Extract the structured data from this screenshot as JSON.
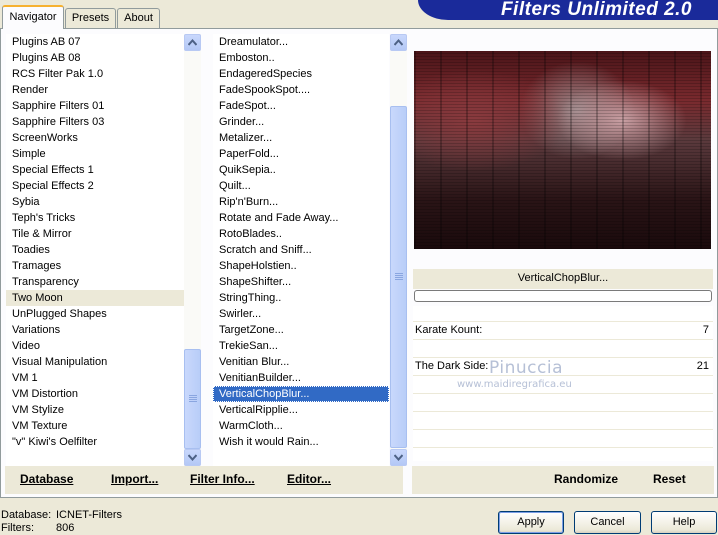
{
  "title": "Filters Unlimited 2.0",
  "tabs": [
    {
      "label": "Navigator",
      "active": true
    },
    {
      "label": "Presets",
      "active": false
    },
    {
      "label": "About",
      "active": false
    }
  ],
  "categories": {
    "items": [
      "Plugins AB 07",
      "Plugins AB 08",
      "RCS Filter Pak 1.0",
      "Render",
      "Sapphire Filters 01",
      "Sapphire Filters 03",
      "ScreenWorks",
      "Simple",
      "Special Effects 1",
      "Special Effects 2",
      "Sybia",
      "Teph's Tricks",
      "Tile & Mirror",
      "Toadies",
      "Tramages",
      "Transparency",
      "Two Moon",
      "UnPlugged Shapes",
      "Variations",
      "Video",
      "Visual Manipulation",
      "VM 1",
      "VM Distortion",
      "VM Stylize",
      "VM Texture",
      "\"v\" Kiwi's Oelfilter"
    ],
    "selected": "Two Moon"
  },
  "filters": {
    "items": [
      "Dreamulator...",
      "Emboston..",
      "EndageredSpecies",
      "FadeSpookSpot....",
      "FadeSpot...",
      "Grinder...",
      "Metalizer...",
      "PaperFold...",
      "QuikSepia..",
      "Quilt...",
      "Rip'n'Burn...",
      "Rotate and Fade Away...",
      "RotoBlades..",
      "Scratch and Sniff...",
      "ShapeHolstien..",
      "ShapeShifter...",
      "StringThing..",
      "Swirler...",
      "TargetZone...",
      "TrekieSan...",
      "Venitian Blur...",
      "VenitianBuilder...",
      "VerticalChopBlur...",
      "VerticalRipplie...",
      "WarmCloth...",
      "Wish it would Rain..."
    ],
    "selected": "VerticalChopBlur..."
  },
  "preview": {
    "filter_name": "VerticalChopBlur...",
    "params": [
      {
        "label": "Karate Kount:",
        "value": "7"
      },
      {
        "label": "The Dark Side:",
        "value": "21"
      }
    ],
    "watermark_name": "Pinuccia",
    "watermark_url": "www.maidiregrafica.eu"
  },
  "toolbar": {
    "database": "Database",
    "import": "Import...",
    "filter_info": "Filter Info...",
    "editor": "Editor...",
    "randomize": "Randomize",
    "reset": "Reset"
  },
  "info": {
    "database_label": "Database:",
    "database_value": "ICNET-Filters",
    "filters_label": "Filters:",
    "filters_value": "806"
  },
  "buttons": {
    "apply": "Apply",
    "cancel": "Cancel",
    "help": "Help"
  }
}
